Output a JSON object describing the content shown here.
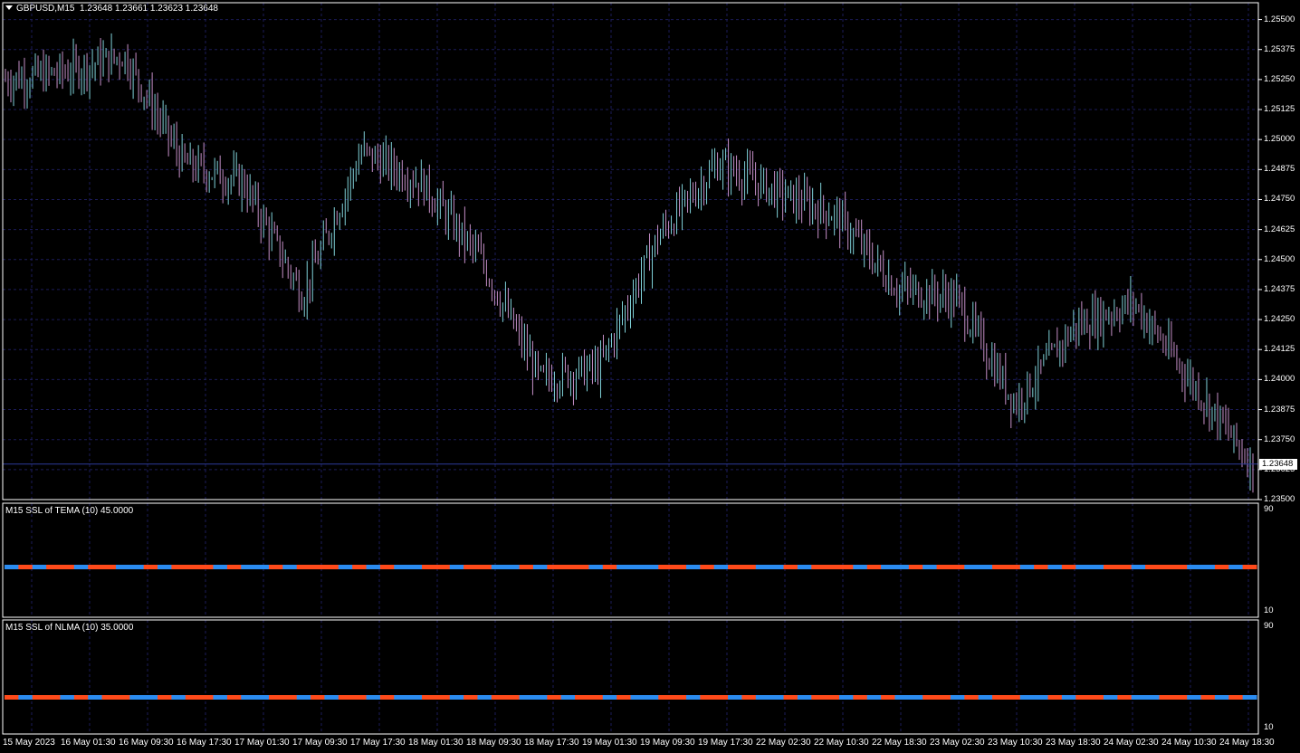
{
  "header": {
    "symbol_label": "GBPUSD,M15",
    "ohlc": "1.23648 1.23661 1.23623 1.23648"
  },
  "colors": {
    "background": "#000000",
    "grid": "#1c1c5a",
    "frame": "#ffffff",
    "bar": "#7fd1d8",
    "bar_down": "#c58fc7",
    "ssl_up": "#2b8cf0",
    "ssl_down": "#ff4a1a",
    "bid_line": "#2d3a9a"
  },
  "price_axis": {
    "ticks": [
      "1.25500",
      "1.25375",
      "1.25250",
      "1.25125",
      "1.25000",
      "1.24875",
      "1.24750",
      "1.24625",
      "1.24500",
      "1.24375",
      "1.24250",
      "1.24125",
      "1.24000",
      "1.23875",
      "1.23750",
      "1.23625",
      "1.23500"
    ],
    "current_price": "1.23648"
  },
  "indicators": [
    {
      "title": "M15 SSL of TEMA (10) 45.0000",
      "max_label": "90",
      "min_label": "10"
    },
    {
      "title": "M15 SSL of NLMA (10) 35.0000",
      "max_label": "90",
      "min_label": "10"
    }
  ],
  "time_axis": [
    "15 May 2023",
    "16 May 01:30",
    "16 May 09:30",
    "16 May 17:30",
    "17 May 01:30",
    "17 May 09:30",
    "17 May 17:30",
    "18 May 01:30",
    "18 May 09:30",
    "18 May 17:30",
    "19 May 01:30",
    "19 May 09:30",
    "19 May 17:30",
    "22 May 02:30",
    "22 May 10:30",
    "22 May 18:30",
    "23 May 02:30",
    "23 May 10:30",
    "23 May 18:30",
    "24 May 02:30",
    "24 May 10:30",
    "24 May 18:30"
  ],
  "chart_data": {
    "type": "line",
    "symbol": "GBPUSD",
    "timeframe": "M15",
    "ylim": [
      1.235,
      1.2557
    ],
    "x": [
      "15 May 2023",
      "16 May 01:30",
      "16 May 09:30",
      "16 May 17:30",
      "17 May 01:30",
      "17 May 09:30",
      "17 May 17:30",
      "18 May 01:30",
      "18 May 09:30",
      "18 May 17:30",
      "19 May 01:30",
      "19 May 09:30",
      "19 May 17:30",
      "22 May 02:30",
      "22 May 10:30",
      "22 May 18:30",
      "23 May 02:30",
      "23 May 10:30",
      "23 May 18:30",
      "24 May 02:30",
      "24 May 10:30",
      "24 May 18:30"
    ],
    "series": [
      {
        "values": [
          1.2525,
          1.2528,
          1.2535,
          1.249,
          1.2482,
          1.2435,
          1.2495,
          1.2482,
          1.245,
          1.24,
          1.2405,
          1.246,
          1.249,
          1.2478,
          1.2468,
          1.2438,
          1.2434,
          1.239,
          1.2422,
          1.2432,
          1.2398,
          1.2364
        ]
      }
    ],
    "ssl_tema": [
      1,
      0,
      1,
      0,
      0,
      1,
      0,
      0,
      1,
      1,
      0,
      1,
      0,
      0,
      0,
      1,
      0,
      1,
      1,
      0,
      1,
      0,
      0,
      0,
      1,
      0,
      1,
      0,
      1,
      1,
      0,
      0,
      1,
      0,
      0,
      1,
      1,
      0,
      1,
      0,
      0,
      0,
      1,
      0,
      1,
      1,
      1,
      0,
      0,
      1,
      0,
      1,
      0,
      0,
      1,
      1,
      0,
      1,
      0,
      0,
      0,
      1,
      0,
      1,
      1,
      0,
      1,
      0,
      0,
      1,
      1,
      0,
      0,
      1,
      0,
      1,
      0,
      1,
      1,
      0,
      0,
      1,
      0,
      0,
      0,
      1,
      1,
      0,
      1,
      0
    ],
    "ssl_nlma": [
      0,
      1,
      0,
      0,
      1,
      0,
      1,
      0,
      0,
      1,
      1,
      0,
      1,
      0,
      0,
      1,
      0,
      1,
      1,
      0,
      0,
      1,
      0,
      1,
      0,
      0,
      1,
      0,
      1,
      1,
      0,
      0,
      1,
      0,
      1,
      0,
      0,
      1,
      1,
      0,
      1,
      0,
      0,
      1,
      0,
      1,
      1,
      0,
      0,
      1,
      0,
      0,
      1,
      0,
      1,
      1,
      0,
      1,
      0,
      0,
      1,
      0,
      1,
      0,
      1,
      1,
      0,
      0,
      1,
      0,
      1,
      0,
      0,
      1,
      1,
      0,
      1,
      0,
      0,
      1,
      0,
      1,
      1,
      0,
      0,
      1,
      0,
      1,
      0,
      1
    ]
  }
}
